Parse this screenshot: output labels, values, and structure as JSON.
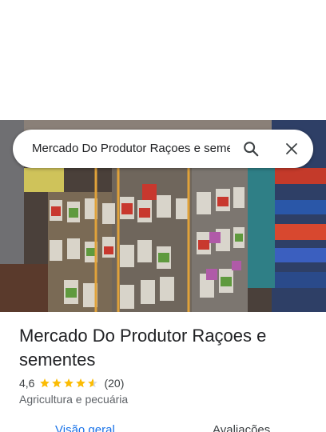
{
  "search": {
    "query": "Mercado Do Produtor Raçoes e sementes"
  },
  "place": {
    "name": "Mercado Do Produtor Raçoes e sementes",
    "rating": "4,6",
    "stars": 4.6,
    "review_count": "(20)",
    "category": "Agricultura e pecuária"
  },
  "tabs": [
    {
      "label": "Visão geral",
      "active": true
    },
    {
      "label": "Avaliações",
      "active": false
    }
  ],
  "colors": {
    "star": "#fbbc04",
    "active_tab": "#1a73e8"
  },
  "icons": {
    "search": "search-icon",
    "close": "close-icon"
  }
}
